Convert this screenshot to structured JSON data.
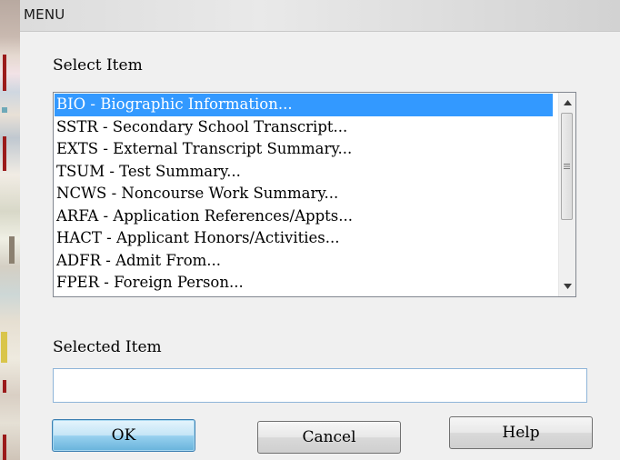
{
  "window": {
    "title": "MENU"
  },
  "select_section": {
    "label": "Select Item",
    "selected_index": 0,
    "items": [
      "BIO - Biographic Information...",
      "SSTR - Secondary School Transcript...",
      "EXTS - External Transcript Summary...",
      "TSUM - Test Summary...",
      "NCWS - Noncourse Work Summary...",
      "ARFA - Application References/Appts...",
      "HACT - Applicant Honors/Activities...",
      "ADFR - Admit From...",
      "FPER - Foreign Person..."
    ]
  },
  "selected_section": {
    "label": "Selected Item",
    "value": "",
    "placeholder": ""
  },
  "buttons": {
    "ok": "OK",
    "cancel": "Cancel",
    "help": "Help"
  },
  "icons": {
    "scroll_up": "scroll-up-arrow-icon",
    "scroll_down": "scroll-down-arrow-icon",
    "scroll_grip": "scroll-grip-icon"
  },
  "colors": {
    "selection": "#3399ff",
    "ok_button": "#98d1ef"
  }
}
